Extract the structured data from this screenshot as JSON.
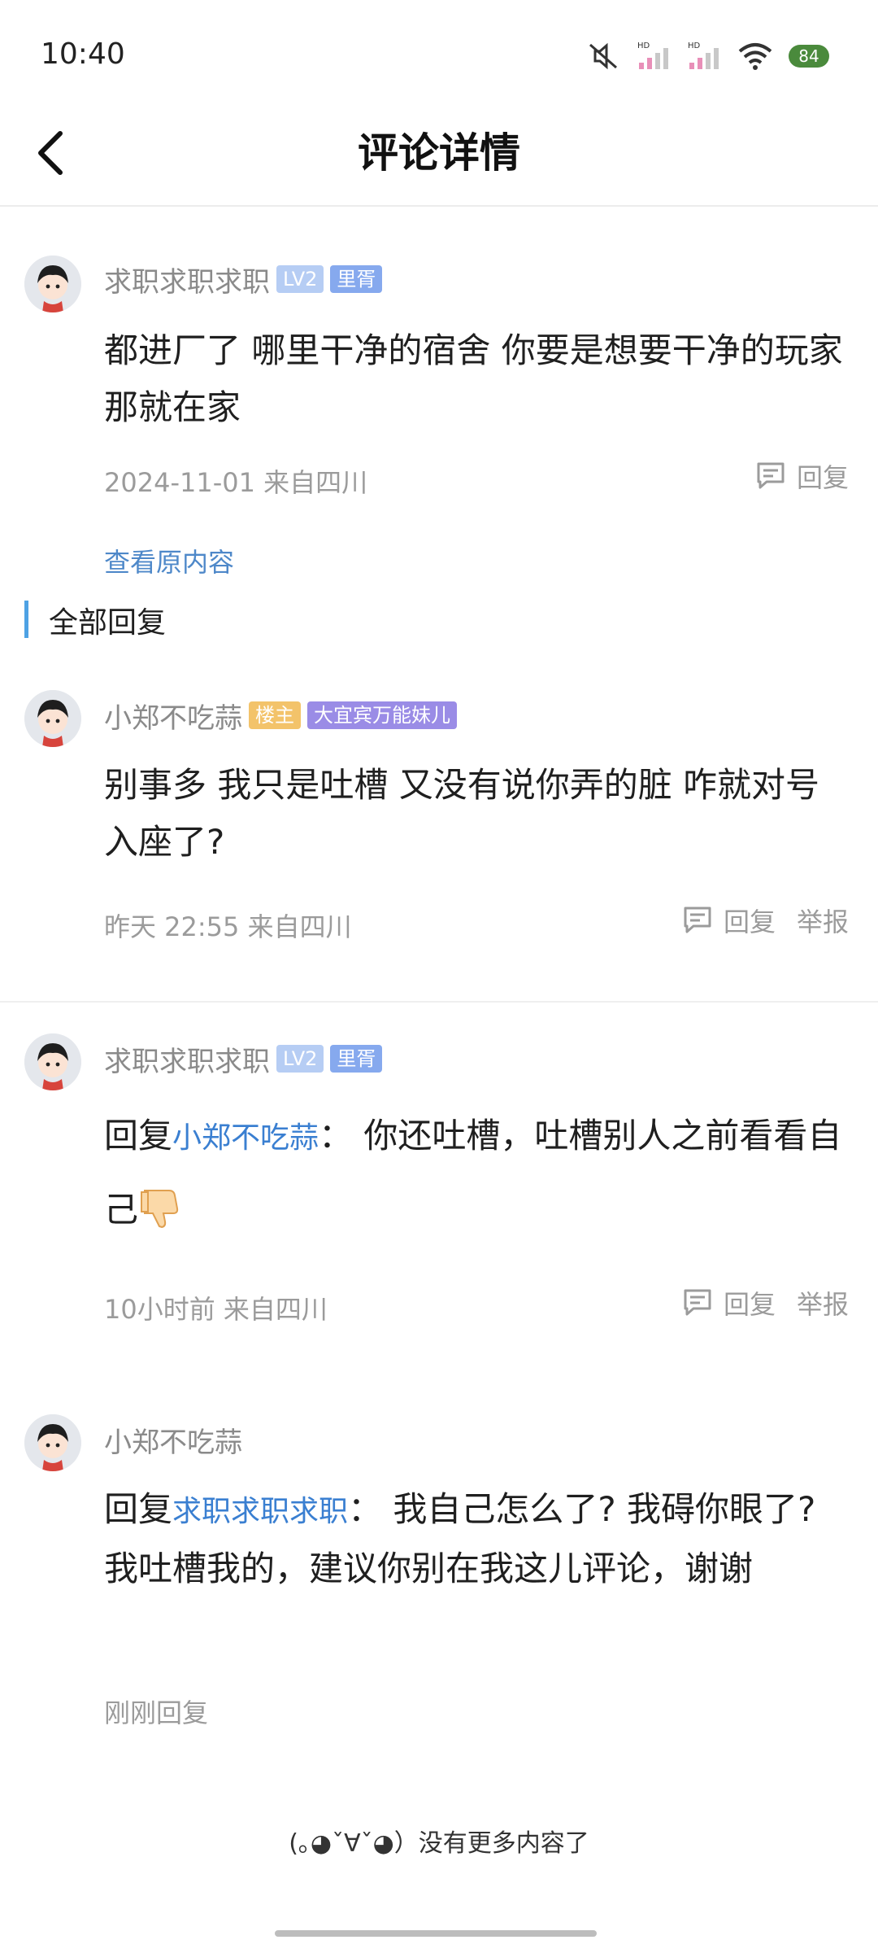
{
  "status_bar": {
    "time": "10:40",
    "battery": "84"
  },
  "header": {
    "title": "评论详情"
  },
  "main_comment": {
    "username": "求职求职求职",
    "badges": [
      "LV2",
      "里胥"
    ],
    "text": "都进厂了 哪里干净的宿舍 你要是想要干净的玩家那就在家",
    "meta": "2024-11-01 来自四川",
    "reply_label": "回复",
    "view_original": "查看原内容"
  },
  "section": {
    "title": "全部回复"
  },
  "replies": [
    {
      "username": "小郑不吃蒜",
      "badges": [
        "楼主",
        "大宜宾万能妹儿"
      ],
      "text": "别事多 我只是吐槽 又没有说你弄的脏 咋就对号入座了?",
      "meta": "昨天 22:55 来自四川",
      "reply_label": "回复",
      "report_label": "举报"
    },
    {
      "username": "求职求职求职",
      "badges": [
        "LV2",
        "里胥"
      ],
      "prefix": "回复",
      "mention": "小郑不吃蒜",
      "sep": "：",
      "text": "你还吐槽，吐槽别人之前看看自己",
      "meta": "10小时前 来自四川",
      "reply_label": "回复",
      "report_label": "举报"
    },
    {
      "username": "小郑不吃蒜",
      "prefix": "回复",
      "mention": "求职求职求职",
      "sep": "：",
      "text": "我自己怎么了? 我碍你眼了? 我吐槽我的，建议你别在我这儿评论，谢谢",
      "meta": "刚刚回复"
    }
  ],
  "footer": {
    "note": "(｡◕ˇ∀ˇ◕）没有更多内容了"
  },
  "colors": {
    "accent": "#4ea2e4",
    "link": "#3a7fd1"
  },
  "icons": [
    "back-icon",
    "mute-icon",
    "signal-icon",
    "wifi-icon",
    "battery-icon",
    "comment-icon",
    "thumbs-down-emoji"
  ]
}
